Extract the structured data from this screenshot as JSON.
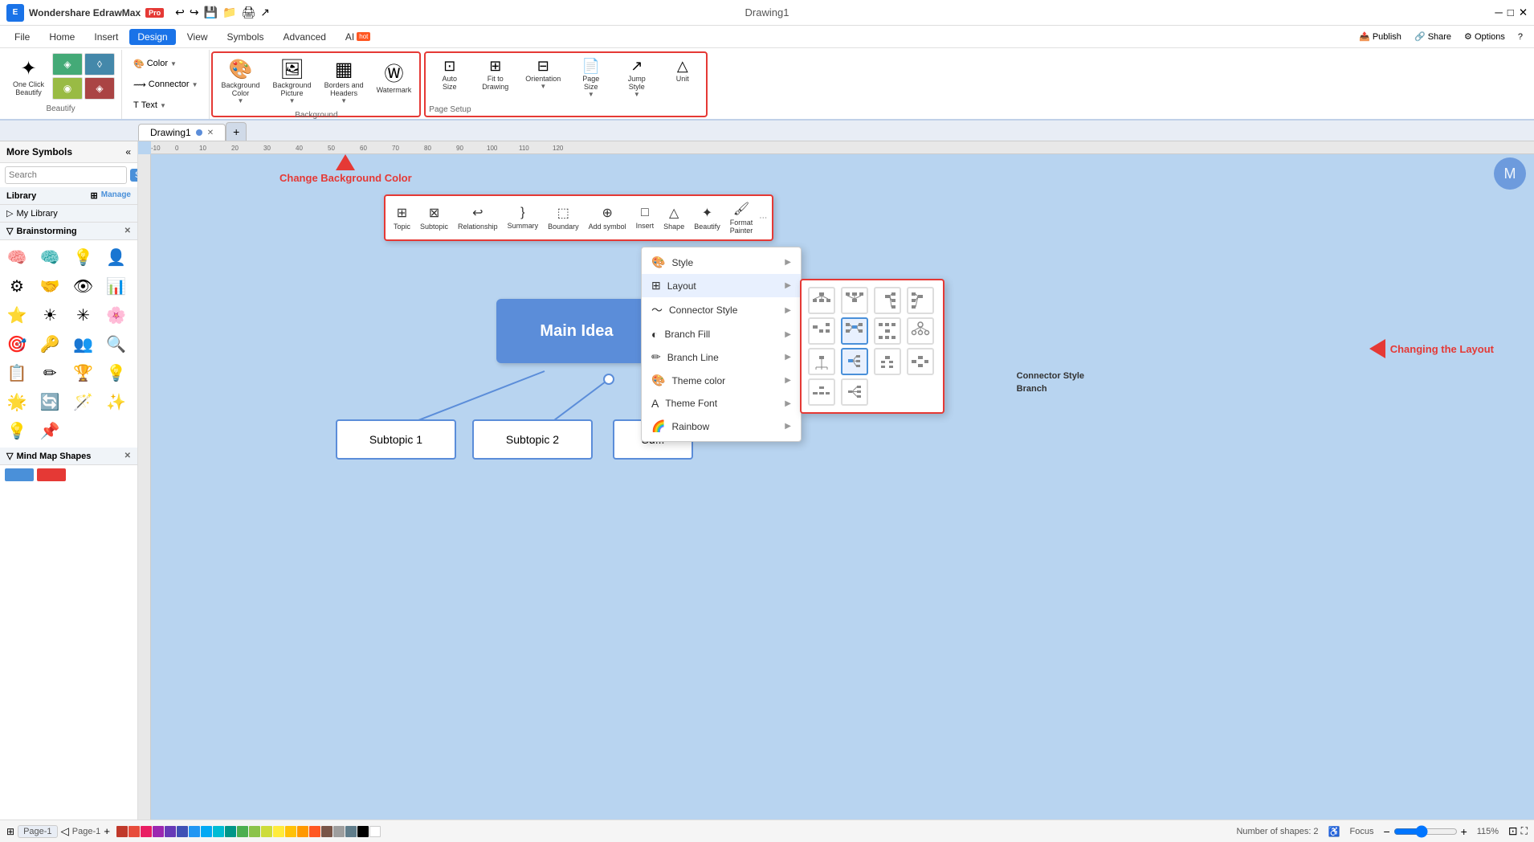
{
  "titlebar": {
    "app_name": "Wondershare EdrawMax",
    "pro_label": "Pro",
    "doc_title": "Drawing1",
    "undo_icon": "↩",
    "redo_icon": "↪",
    "min_icon": "─",
    "max_icon": "□",
    "close_icon": "✕"
  },
  "menubar": {
    "items": [
      {
        "id": "file",
        "label": "File"
      },
      {
        "id": "home",
        "label": "Home"
      },
      {
        "id": "insert",
        "label": "Insert"
      },
      {
        "id": "design",
        "label": "Design",
        "active": true
      },
      {
        "id": "view",
        "label": "View"
      },
      {
        "id": "symbols",
        "label": "Symbols"
      },
      {
        "id": "advanced",
        "label": "Advanced"
      },
      {
        "id": "ai",
        "label": "AI",
        "badge": "hot"
      }
    ],
    "right_items": [
      {
        "id": "publish",
        "label": "Publish"
      },
      {
        "id": "share",
        "label": "Share"
      },
      {
        "id": "options",
        "label": "Options"
      }
    ]
  },
  "ribbon": {
    "highlight_border": "#e53935",
    "groups": [
      {
        "id": "beautify",
        "label": "Beautify",
        "buttons": [
          {
            "id": "one-click-beautify",
            "icon": "✦",
            "label": "One Click\nBeautify"
          },
          {
            "id": "style-btn1",
            "icon": "◈",
            "label": ""
          },
          {
            "id": "style-btn2",
            "icon": "◉",
            "label": ""
          },
          {
            "id": "style-btn3",
            "icon": "◊",
            "label": ""
          }
        ]
      }
    ],
    "color_connector_text": {
      "color_label": "Color",
      "connector_label": "Connector",
      "text_label": "Text"
    },
    "background_group": {
      "label": "Background",
      "highlighted": true,
      "buttons": [
        {
          "id": "background-color",
          "icon": "🎨",
          "label": "Background\nColor"
        },
        {
          "id": "background-picture",
          "icon": "🖼",
          "label": "Background\nPicture"
        },
        {
          "id": "borders-headers",
          "icon": "▦",
          "label": "Borders and\nHeaders"
        },
        {
          "id": "watermark",
          "icon": "Ⓦ",
          "label": "Watermark"
        }
      ]
    },
    "page_setup_group": {
      "label": "Page Setup",
      "highlighted": true,
      "buttons": [
        {
          "id": "auto-size",
          "icon": "⊡",
          "label": "Auto\nSize"
        },
        {
          "id": "fit-to-drawing",
          "icon": "⊞",
          "label": "Fit to\nDrawing"
        },
        {
          "id": "orientation",
          "icon": "⊟",
          "label": "Orientation"
        },
        {
          "id": "page-size",
          "icon": "📄",
          "label": "Page\nSize"
        },
        {
          "id": "jump-style",
          "icon": "↗",
          "label": "Jump\nStyle"
        },
        {
          "id": "unit",
          "icon": "📏",
          "label": "Unit"
        }
      ]
    }
  },
  "tabs": {
    "items": [
      {
        "id": "drawing1",
        "label": "Drawing1",
        "active": true
      }
    ],
    "add_label": "+"
  },
  "left_panel": {
    "header": {
      "title": "More Symbols",
      "collapse_icon": "«"
    },
    "search": {
      "placeholder": "Search",
      "button_label": "Search"
    },
    "library": {
      "title": "Library",
      "manage_label": "Manage"
    },
    "my_library": {
      "title": "My Library"
    },
    "brainstorming": {
      "title": "Brainstorming",
      "close_icon": "✕"
    },
    "mind_map_shapes": {
      "title": "Mind Map Shapes",
      "close_icon": "✕"
    }
  },
  "floating_toolbar": {
    "buttons": [
      {
        "id": "topic",
        "icon": "⊞",
        "label": "Topic"
      },
      {
        "id": "subtopic",
        "icon": "⊠",
        "label": "Subtopic"
      },
      {
        "id": "relationship",
        "icon": "↩",
        "label": "Relationship"
      },
      {
        "id": "summary",
        "icon": "}",
        "label": "Summary"
      },
      {
        "id": "boundary",
        "icon": "⬚",
        "label": "Boundary"
      },
      {
        "id": "add-symbol",
        "icon": "⊕",
        "label": "Add symbol"
      },
      {
        "id": "insert",
        "icon": "□",
        "label": "Insert"
      },
      {
        "id": "shape",
        "icon": "△",
        "label": "Shape"
      },
      {
        "id": "beautify",
        "icon": "✦",
        "label": "Beautify"
      },
      {
        "id": "format-painter",
        "icon": "🖌",
        "label": "Format\nPainter"
      }
    ]
  },
  "context_menu": {
    "items": [
      {
        "id": "style",
        "icon": "🎨",
        "label": "Style",
        "has_arrow": true
      },
      {
        "id": "layout",
        "icon": "⊞",
        "label": "Layout",
        "has_arrow": true
      },
      {
        "id": "connector-style",
        "icon": "~",
        "label": "Connector Style",
        "has_arrow": true
      },
      {
        "id": "branch-fill",
        "icon": "◐",
        "label": "Branch Fill",
        "has_arrow": true
      },
      {
        "id": "branch-line",
        "icon": "✏",
        "label": "Branch Line",
        "has_arrow": true
      },
      {
        "id": "theme-color",
        "icon": "🎨",
        "label": "Theme color",
        "has_arrow": true
      },
      {
        "id": "theme-font",
        "icon": "A",
        "label": "Theme Font",
        "has_arrow": true
      },
      {
        "id": "rainbow",
        "icon": "🌈",
        "label": "Rainbow",
        "has_arrow": true
      }
    ]
  },
  "layout_panel": {
    "items": [
      {
        "id": "layout-1",
        "selected": false
      },
      {
        "id": "layout-2",
        "selected": false
      },
      {
        "id": "layout-3",
        "selected": false
      },
      {
        "id": "layout-4",
        "selected": false
      },
      {
        "id": "layout-5",
        "selected": false
      },
      {
        "id": "layout-6",
        "selected": true
      },
      {
        "id": "layout-7",
        "selected": false
      },
      {
        "id": "layout-8",
        "selected": false
      },
      {
        "id": "layout-9",
        "selected": false
      },
      {
        "id": "layout-10",
        "selected": true
      },
      {
        "id": "layout-11",
        "selected": false
      },
      {
        "id": "layout-12",
        "selected": false
      },
      {
        "id": "layout-13",
        "selected": false
      },
      {
        "id": "layout-14",
        "selected": false
      }
    ]
  },
  "mindmap": {
    "main_idea_label": "Main Idea",
    "subtopics": [
      {
        "id": "s1",
        "label": "Subtopic 1"
      },
      {
        "id": "s2",
        "label": "Subtopic 2"
      },
      {
        "id": "s3",
        "label": "Su..."
      }
    ]
  },
  "annotations": {
    "change_bg_color": "Change Background Color",
    "changing_layout": "Changing the Layout"
  },
  "branch_labels": {
    "branch": "Branch",
    "connector_style": "Connector Style"
  },
  "statusbar": {
    "page_label": "Page-1",
    "shapes_label": "Number of shapes: 2",
    "focus_label": "Focus",
    "zoom_level": "115%",
    "fit_icon": "⊡"
  },
  "colors": {
    "accent_blue": "#1a73e8",
    "highlight_red": "#e53935",
    "main_idea_bg": "#5b8dd9",
    "canvas_bg": "#b8d4f0",
    "subtopic_border": "#5b8dd9"
  },
  "color_palette": [
    "#c0392b",
    "#e74c3c",
    "#e91e63",
    "#9c27b0",
    "#673ab7",
    "#3f51b5",
    "#2196f3",
    "#03a9f4",
    "#00bcd4",
    "#009688",
    "#4caf50",
    "#8bc34a",
    "#cddc39",
    "#ffeb3b",
    "#ffc107",
    "#ff9800",
    "#ff5722",
    "#795548",
    "#9e9e9e",
    "#607d8b",
    "#000000",
    "#ffffff"
  ]
}
